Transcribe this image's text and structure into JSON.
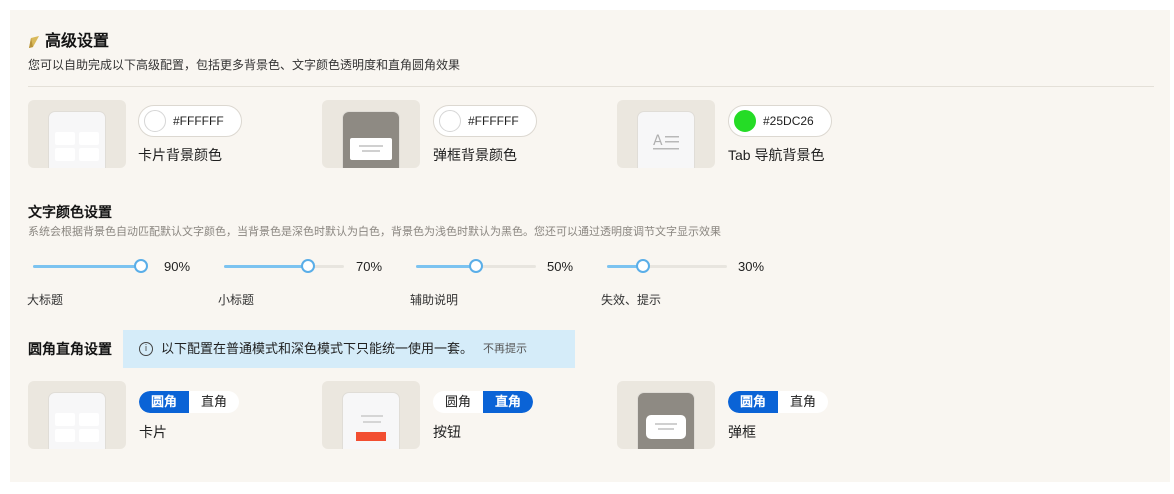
{
  "header": {
    "title": "高级设置",
    "description": "您可以自助完成以下高级配置，包括更多背景色、文字颜色透明度和直角圆角效果"
  },
  "background_colors": [
    {
      "label": "卡片背景颜色",
      "hex": "#FFFFFF",
      "swatch": "#FFFFFF"
    },
    {
      "label": "弹框背景颜色",
      "hex": "#FFFFFF",
      "swatch": "#FFFFFF"
    },
    {
      "label": "Tab 导航背景色",
      "hex": "#25DC26",
      "swatch": "#25DC26"
    }
  ],
  "text_color": {
    "title": "文字颜色设置",
    "description": "系统会根据背景色自动匹配默认文字颜色，当背景色是深色时默认为白色，背景色为浅色时默认为黑色。您还可以通过透明度调节文字显示效果",
    "sliders": [
      {
        "label": "大标题",
        "value": 90,
        "display": "90%"
      },
      {
        "label": "小标题",
        "value": 70,
        "display": "70%"
      },
      {
        "label": "辅助说明",
        "value": 50,
        "display": "50%"
      },
      {
        "label": "失效、提示",
        "value": 30,
        "display": "30%"
      }
    ]
  },
  "corner": {
    "title": "圆角直角设置",
    "notice": "以下配置在普通模式和深色模式下只能统一使用一套。",
    "dismiss": "不再提示",
    "options": {
      "rounded": "圆角",
      "square": "直角"
    },
    "items": [
      {
        "label": "卡片",
        "selected": "圆角"
      },
      {
        "label": "按钮",
        "selected": "直角"
      },
      {
        "label": "弹框",
        "selected": "圆角"
      }
    ]
  },
  "colors": {
    "accent": "#0A63D6",
    "slider_fill": "#7CC3F0",
    "notice_bg": "#D5ECF9",
    "button_red": "#F24E31"
  }
}
